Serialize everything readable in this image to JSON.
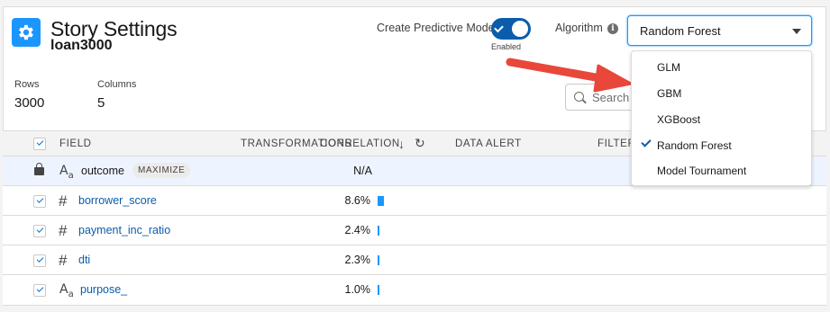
{
  "header": {
    "title": "Story Settings",
    "subtitle": "loan3000",
    "icon": "gear-icon",
    "accent_color": "#1b96ff"
  },
  "stats": {
    "rows_label": "Rows",
    "rows_value": "3000",
    "columns_label": "Columns",
    "columns_value": "5"
  },
  "predictive_model": {
    "label": "Create Predictive Model",
    "state_label": "Enabled",
    "enabled": true
  },
  "algorithm": {
    "label": "Algorithm",
    "info_icon": "info-icon",
    "selected": "Random Forest",
    "options": [
      {
        "label": "GLM",
        "checked": false
      },
      {
        "label": "GBM",
        "checked": false
      },
      {
        "label": "XGBoost",
        "checked": false
      },
      {
        "label": "Random Forest",
        "checked": true
      },
      {
        "label": "Model Tournament",
        "checked": false
      }
    ]
  },
  "search": {
    "placeholder": "Search"
  },
  "table": {
    "headers": {
      "field": "FIELD",
      "transformations": "TRANSFORMATIONS",
      "correlation": "CORRELATION",
      "data_alert": "DATA ALERT",
      "filter": "FILTER"
    },
    "rows": [
      {
        "type": "text",
        "name": "outcome",
        "badge": "MAXIMIZE",
        "correlation": "N/A",
        "corr_value": null,
        "locked": true
      },
      {
        "type": "number",
        "name": "borrower_score",
        "correlation": "8.6%",
        "corr_value": 8.6
      },
      {
        "type": "number",
        "name": "payment_inc_ratio",
        "correlation": "2.4%",
        "corr_value": 2.4
      },
      {
        "type": "number",
        "name": "dti",
        "correlation": "2.3%",
        "corr_value": 2.3
      },
      {
        "type": "text",
        "name": "purpose_",
        "correlation": "1.0%",
        "corr_value": 1.0
      }
    ]
  }
}
